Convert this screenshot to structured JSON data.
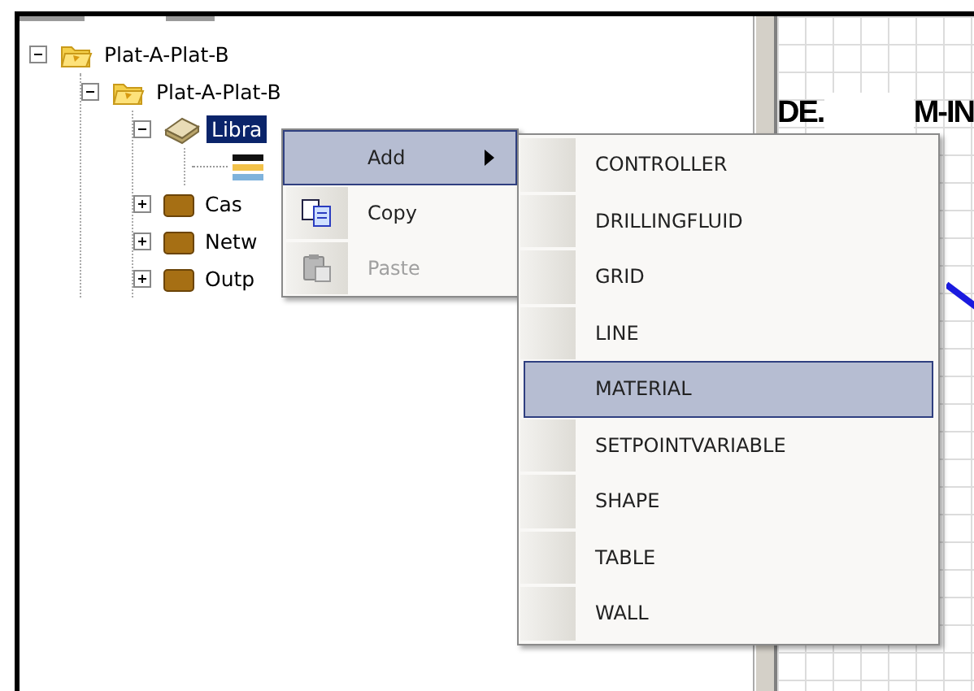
{
  "tree": [
    {
      "label": "Plat-A-Plat-B",
      "kind": "project",
      "expanded": true,
      "selected": false,
      "children": [
        {
          "label": "Plat-A-Plat-B",
          "kind": "project",
          "expanded": true,
          "selected": false,
          "children": [
            {
              "label": "Libra",
              "kind": "book",
              "expanded": true,
              "selected": true,
              "children": [
                {
                  "kind": "swatch"
                }
              ]
            },
            {
              "label": "Cas",
              "kind": "folder",
              "expanded": false,
              "selected": false
            },
            {
              "label": "Netw",
              "kind": "folder",
              "expanded": false,
              "selected": false
            },
            {
              "label": "Outp",
              "kind": "folder",
              "expanded": false,
              "selected": false
            }
          ]
        }
      ]
    }
  ],
  "context_menu": {
    "items": [
      {
        "label": "Add",
        "kind": "submenu",
        "selected": true,
        "disabled": false
      },
      {
        "label": "Copy",
        "kind": "copy",
        "selected": false,
        "disabled": false
      },
      {
        "label": "Paste",
        "kind": "paste",
        "selected": false,
        "disabled": true
      }
    ]
  },
  "submenu": {
    "items": [
      {
        "label": "CONTROLLER",
        "selected": false
      },
      {
        "label": "DRILLINGFLUID",
        "selected": false
      },
      {
        "label": "GRID",
        "selected": false
      },
      {
        "label": "LINE",
        "selected": false
      },
      {
        "label": "MATERIAL",
        "selected": true
      },
      {
        "label": "SETPOINTVARIABLE",
        "selected": false
      },
      {
        "label": "SHAPE",
        "selected": false
      },
      {
        "label": "TABLE",
        "selected": false
      },
      {
        "label": "WALL",
        "selected": false
      }
    ]
  },
  "canvas": {
    "labels": [
      "DE.",
      "M-IN"
    ]
  }
}
